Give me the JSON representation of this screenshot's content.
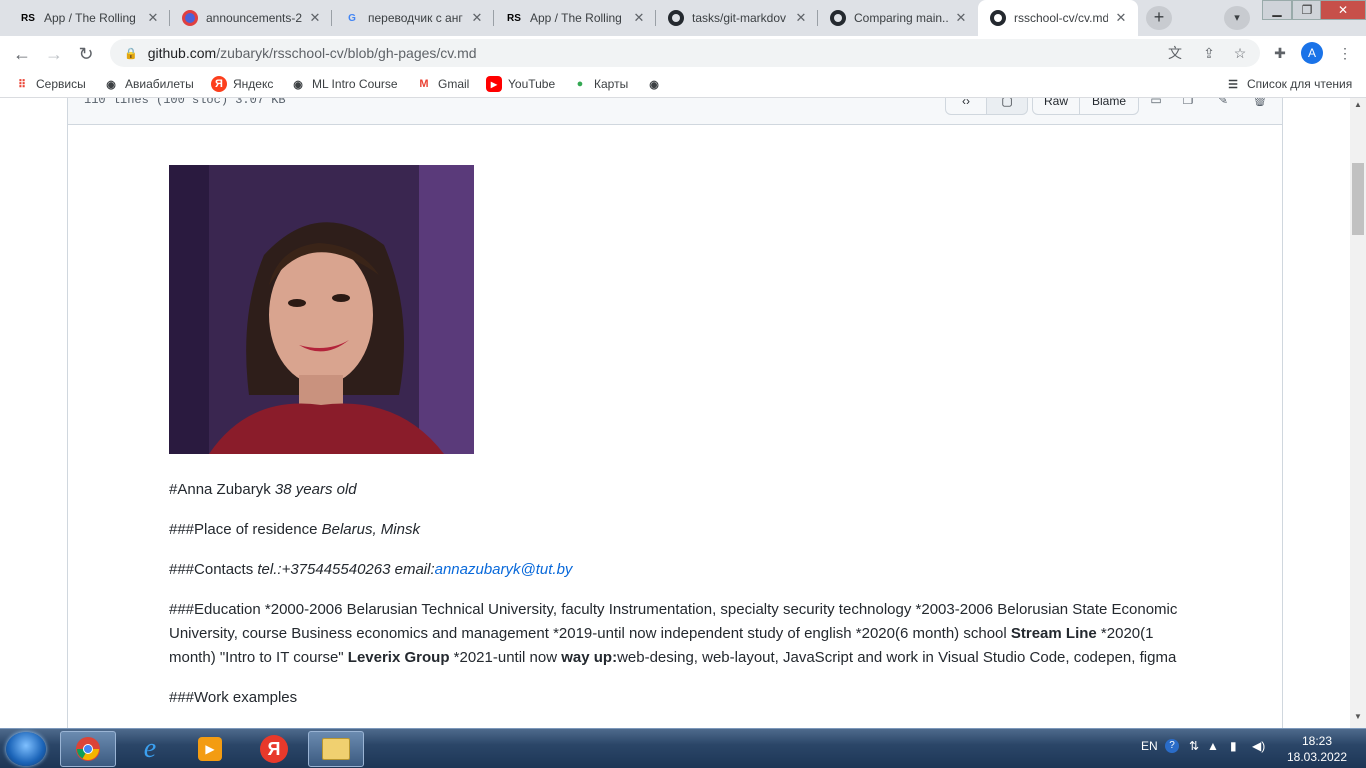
{
  "browser": {
    "tabs": [
      {
        "title": "App / The Rolling",
        "favicon": "rs-logo"
      },
      {
        "title": "announcements-2",
        "favicon": "announce-icon"
      },
      {
        "title": "переводчик с анг",
        "favicon": "google-icon"
      },
      {
        "title": "App / The Rolling",
        "favicon": "rs-logo"
      },
      {
        "title": "tasks/git-markdov",
        "favicon": "github-icon"
      },
      {
        "title": "Comparing main...",
        "favicon": "github-icon"
      },
      {
        "title": "rsschool-cv/cv.md",
        "favicon": "github-icon",
        "active": true
      }
    ],
    "url_host": "github.com",
    "url_path": "/zubaryk/rsschool-cv/blob/gh-pages/cv.md",
    "profile_initial": "A"
  },
  "bookmarks": {
    "items": [
      {
        "label": "Сервисы",
        "icon": "apps-grid-icon"
      },
      {
        "label": "Авиабилеты",
        "icon": "globe-icon"
      },
      {
        "label": "Яндекс",
        "icon": "yandex-icon"
      },
      {
        "label": "ML Intro Course",
        "icon": "globe-icon"
      },
      {
        "label": "Gmail",
        "icon": "gmail-icon"
      },
      {
        "label": "YouTube",
        "icon": "youtube-icon"
      },
      {
        "label": "Карты",
        "icon": "maps-pin-icon"
      }
    ],
    "reading_list": "Список для чтения"
  },
  "file_header": {
    "info": "110 lines (100 sloc)   3.07 KB",
    "raw_label": "Raw",
    "blame_label": "Blame"
  },
  "cv": {
    "name_prefix": "#Anna Zubaryk ",
    "age": "38 years old",
    "residence_prefix": "###Place of residence ",
    "residence": "Belarus, Minsk",
    "contacts_prefix": "###Contacts ",
    "contacts_tel": "tel.:+375445540263 email:",
    "email": "annazubaryk@tut.by",
    "edu_part1": "###Education *2000-2006 Belarusian Technical University, faculty Instrumentation, specialty security technology *2003-2006 Belorusian State Economic University, course Business economics and management *2019-until now independent study of english *2020(6 month) school ",
    "edu_bold1": "Stream Line",
    "edu_part2": " *2020(1 month) \"Intro to IT course\" ",
    "edu_bold2": "Leverix Group",
    "edu_part3": " *2021-until now ",
    "edu_bold3": "way up:",
    "edu_part4": "web-desing, web-layout, JavaScript and work in Visual Studio Code, codepen, figma",
    "work_examples": "###Work examples"
  },
  "taskbar": {
    "lang": "EN",
    "time": "18:23",
    "date": "18.03.2022"
  },
  "colors": {
    "link": "#0969da",
    "tabstrip": "#dee1e6",
    "taskbar": "#2b4668"
  }
}
